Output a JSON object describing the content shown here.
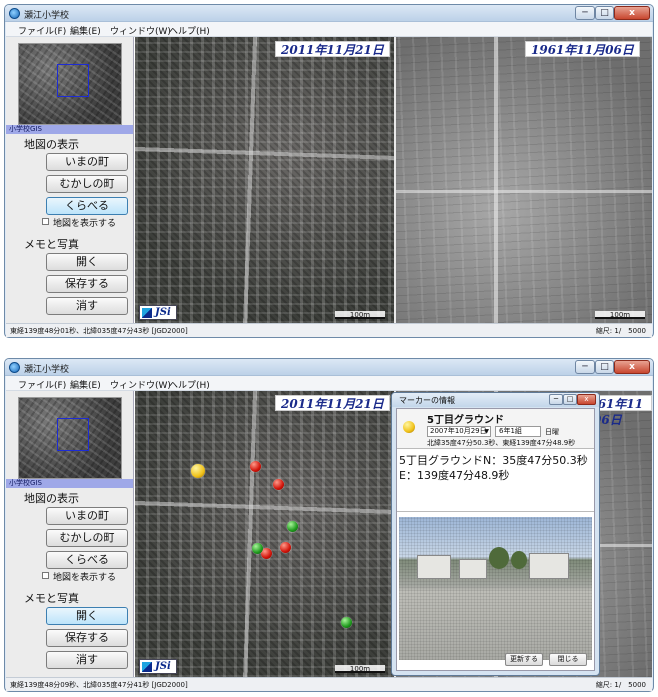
{
  "window_title": "瀬江小学校",
  "window_controls": {
    "minimize": "─",
    "maximize": "□",
    "close": "x"
  },
  "menu": [
    "ファイル(F)",
    "編集(E)",
    "ウィンドウ(W)",
    "ヘルプ(H)"
  ],
  "sidebar": {
    "gis_label": "小学校GIS",
    "map_section": "地図の表示",
    "btn_now": "いまの町",
    "btn_old": "むかしの町",
    "btn_compare": "くらべる",
    "show_map_checkbox": "地図を表示する",
    "memo_section": "メモと写真",
    "btn_open": "開く",
    "btn_save": "保存する",
    "btn_delete": "消す"
  },
  "map": {
    "date_new": "2011年11月21日",
    "date_old": "1961年11月06日",
    "scale_label": "100m",
    "logo": "JSi"
  },
  "status_top": {
    "coords": "東経139度48分01秒、北緯035度47分43秒 [JGD2000]",
    "scale": "縮尺: 1/　5000"
  },
  "status_bottom": {
    "coords": "東経139度48分09秒、北緯035度47分41秒 [JGD2000]",
    "scale": "縮尺: 1/　5000"
  },
  "popup": {
    "title": "マーカーの情報",
    "name": "5丁目グラウンド",
    "date": "2007年10月29日",
    "class": "6年1組",
    "day": "日曜",
    "coords": "北緯35度47分50.3秒、東経139度47分48.9秒",
    "note": "5丁目グラウンドN：35度47分50.3秒E：139度47分48.9秒",
    "btn_update": "更新する",
    "btn_close": "閉じる"
  },
  "colors": {
    "accent": "#1a2a8a",
    "gis_bar": "#9fa8e8",
    "marker_red": "#d2140a",
    "marker_green": "#1f9a1d",
    "marker_yellow": "#f0c21a"
  }
}
